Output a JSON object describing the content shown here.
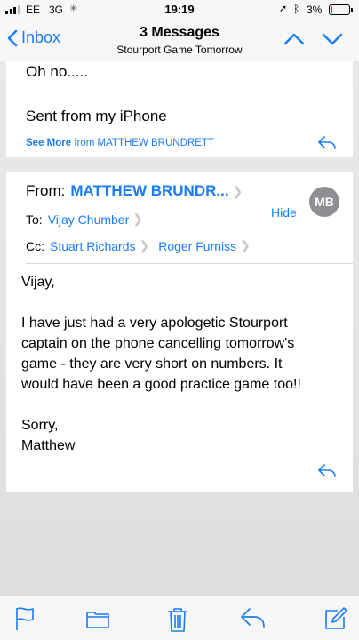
{
  "status_bar": {
    "carrier": "EE",
    "network": "3G",
    "time": "19:19",
    "battery_percent": "3%",
    "signal_bars": 3,
    "battery_level": 0.03
  },
  "nav": {
    "back_label": "Inbox",
    "title": "3 Messages",
    "subtitle": "Stourport Game Tomorrow"
  },
  "messages": [
    {
      "lines": [
        "Oh no.....",
        "Sent from my iPhone"
      ],
      "see_more": "See More",
      "see_more_from": "from MATTHEW BRUNDRETT"
    },
    {
      "from_label": "From:",
      "from_name": "MATTHEW BRUNDR...",
      "to_label": "To:",
      "to": [
        "Vijay Chumber"
      ],
      "cc_label": "Cc:",
      "cc": [
        "Stuart Richards",
        "Roger Furniss"
      ],
      "hide_label": "Hide",
      "avatar_initials": "MB",
      "body": [
        "Vijay,",
        "",
        "I have just had a very apologetic Stourport",
        "captain on the phone cancelling tomorrow's",
        "game - they are very short on numbers. It",
        "would have been a good practice game too!!",
        "",
        "Sorry,",
        "Matthew"
      ]
    }
  ],
  "toolbar": {
    "icons": [
      "flag-icon",
      "folder-icon",
      "trash-icon",
      "reply-icon",
      "compose-icon"
    ]
  },
  "colors": {
    "accent": "#1a7cf6",
    "avatar": "#8e8e93",
    "battery_low": "#e02020"
  }
}
